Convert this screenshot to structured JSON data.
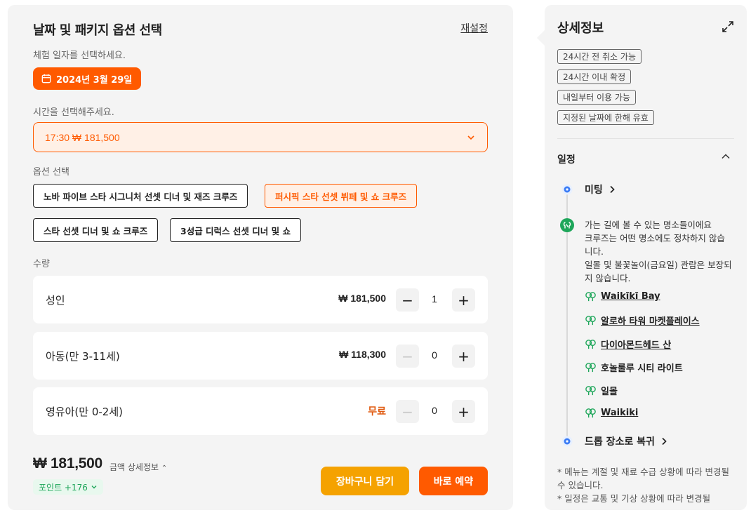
{
  "booking": {
    "title": "날짜 및 패키지 옵션 선택",
    "reset_label": "재설정",
    "date_prompt": "체험 일자를 선택하세요.",
    "selected_date": "2024년 3월 29일",
    "time_prompt": "시간을 선택해주세요.",
    "selected_time": "17:30 ₩ 181,500",
    "option_prompt": "옵션 선택",
    "options": [
      {
        "label": "노바 파이브 스타 시그니처 선셋 디너 및 재즈 크루즈",
        "selected": false
      },
      {
        "label": "퍼시픽 스타 선셋 뷔페 및 쇼 크루즈",
        "selected": true
      },
      {
        "label": "스타 선셋 디너 및 쇼 크루즈",
        "selected": false
      },
      {
        "label": "3성급 디럭스 선셋 디너 및 쇼",
        "selected": false
      }
    ],
    "quantity_prompt": "수량",
    "quantities": [
      {
        "name": "성인",
        "price": "₩ 181,500",
        "count": "1",
        "minus_enabled": true
      },
      {
        "name": "아동(만 3-11세)",
        "price": "₩ 118,300",
        "count": "0",
        "minus_enabled": false
      },
      {
        "name": "영유아(만 0-2세)",
        "price": "무료",
        "count": "0",
        "minus_enabled": false
      }
    ],
    "total": "₩ 181,500",
    "amount_detail": "금액 상세정보",
    "points": "포인트 +176",
    "cart_label": "장바구니 담기",
    "book_label": "바로 예약",
    "accent_color": "#ff5a00",
    "cart_color": "#f5a200"
  },
  "details": {
    "title": "상세정보",
    "tags": [
      "24시간 전 취소 가능",
      "24시간 이내 확정",
      "내일부터 이용 가능",
      "지정된 날짜에 한해 유효"
    ],
    "schedule_title": "일정",
    "meeting_label": "미팅",
    "description": "가는 길에 볼 수 있는 명소들이에요\n크루즈는 어떤 명소에도 정차하지 않습니다.\n일몰 및 불꽃놀이(금요일) 관람은 보장되지 않습니다.",
    "places": [
      {
        "name": "Waikīkī Bay",
        "link": true
      },
      {
        "name": "알로하 타워 마켓플레이스",
        "link": true
      },
      {
        "name": "다이아몬드헤드 산",
        "link": true
      },
      {
        "name": "호놀룰루 시티 라이트",
        "link": false
      },
      {
        "name": "일몰",
        "link": false
      },
      {
        "name": "Waikiki",
        "link": true
      }
    ],
    "dropoff_label": "드롭 장소로 복귀",
    "notes": "* 메뉴는 계절 및 재료 수급 상황에 따라 변경될 수 있습니다.\n* 일정은 교통 및 기상 상황에 따라 변경될"
  }
}
